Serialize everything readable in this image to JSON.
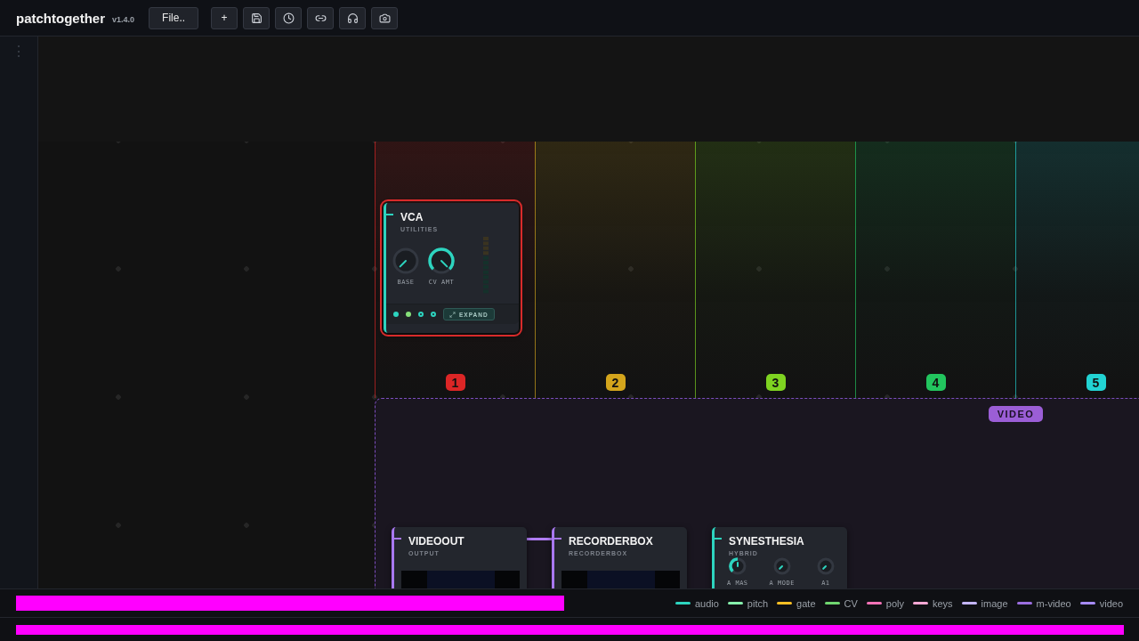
{
  "app": {
    "name": "patchtogether",
    "version": "v1.4.0"
  },
  "toolbar": {
    "file_button": "File..",
    "buttons": [
      {
        "kind": "text",
        "label": "+"
      },
      {
        "kind": "save"
      },
      {
        "kind": "clock"
      },
      {
        "kind": "link"
      },
      {
        "kind": "headphones"
      },
      {
        "kind": "camera"
      }
    ]
  },
  "sidebar": {
    "handle": "⋮"
  },
  "rails": [
    {
      "label": "1",
      "color": "#dc2626"
    },
    {
      "label": "2",
      "color": "#d4a51c"
    },
    {
      "label": "3",
      "color": "#7ed321"
    },
    {
      "label": "4",
      "color": "#22c55e"
    },
    {
      "label": "5",
      "color": "#22d3d3"
    }
  ],
  "zone": {
    "label": "VIDEO"
  },
  "modules": [
    {
      "title": "VCA",
      "subtitle": "UTILITIES",
      "kind": "control",
      "selected": true,
      "color": "#2dd4bf",
      "knobs": [
        {
          "label": "BASE"
        },
        {
          "label": "CV AMT"
        }
      ],
      "ports": [
        {
          "color": "#2dd4bf",
          "connected": true
        },
        {
          "color": "#86e07a",
          "connected": true
        },
        {
          "color": "#2dd4bf",
          "connected": false
        },
        {
          "color": "#2dd4bf",
          "connected": false
        }
      ],
      "expand": "EXPAND"
    },
    {
      "title": "VIDEOOUT",
      "subtitle": "OUTPUT",
      "kind": "video",
      "selected": false,
      "color": "#a878f0"
    },
    {
      "title": "RECORDERBOX",
      "subtitle": "RECORDERBOX",
      "kind": "video",
      "selected": false,
      "color": "#a878f0"
    },
    {
      "title": "SYNESTHESIA",
      "subtitle": "HYBRID",
      "kind": "control",
      "selected": false,
      "color": "#2dd4bf",
      "knobs": [
        {
          "label": "A MAS"
        },
        {
          "label": "A MODE"
        },
        {
          "label": "A1"
        }
      ]
    }
  ],
  "cables": [
    {
      "color": "#b07cf5"
    }
  ],
  "legend": [
    {
      "name": "audio",
      "color": "#2dd4bf"
    },
    {
      "name": "pitch",
      "color": "#86efac"
    },
    {
      "name": "gate",
      "color": "#fbbf24"
    },
    {
      "name": "CV",
      "color": "#6fd66f"
    },
    {
      "name": "poly",
      "color": "#f472b6"
    },
    {
      "name": "keys",
      "color": "#f9a8d4"
    },
    {
      "name": "image",
      "color": "#c4b5fd"
    },
    {
      "name": "m-video",
      "color": "#9b6ee0"
    },
    {
      "name": "video",
      "color": "#a78bfa"
    }
  ]
}
